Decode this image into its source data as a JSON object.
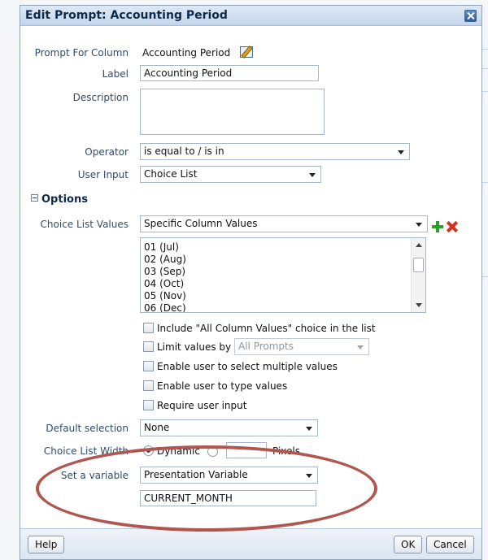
{
  "dialog": {
    "title": "Edit Prompt: Accounting Period"
  },
  "form": {
    "prompt_for_column_label": "Prompt For Column",
    "prompt_for_column_value": "Accounting Period",
    "label_label": "Label",
    "label_value": "Accounting Period",
    "description_label": "Description",
    "description_value": "",
    "operator_label": "Operator",
    "operator_value": "is equal to / is in",
    "user_input_label": "User Input",
    "user_input_value": "Choice List"
  },
  "options": {
    "section_title": "Options",
    "choice_list_values_label": "Choice List Values",
    "choice_list_values_value": "Specific Column Values",
    "list_items": [
      "01 (Jul)",
      "02 (Aug)",
      "03 (Sep)",
      "04 (Oct)",
      "05 (Nov)",
      "06 (Dec)"
    ],
    "checkboxes": {
      "include_all": "Include \"All Column Values\" choice in the list",
      "limit_values_by": "Limit values by",
      "limit_values_by_select": "All Prompts",
      "multiple_values": "Enable user to select multiple values",
      "type_values": "Enable user to type values",
      "require_input": "Require user input"
    },
    "default_selection_label": "Default selection",
    "default_selection_value": "None",
    "choice_list_width_label": "Choice List Width",
    "width_dynamic": "Dynamic",
    "width_pixels_value": "",
    "width_pixels_unit": "Pixels",
    "set_variable_label": "Set a variable",
    "set_variable_value": "Presentation Variable",
    "variable_name_value": "CURRENT_MONTH"
  },
  "footer": {
    "help": "Help",
    "ok": "OK",
    "cancel": "Cancel"
  },
  "colors": {
    "title_bar": "#c4d6ec",
    "highlight_oval": "#b0564e",
    "add_icon": "#2e9e2e",
    "remove_icon": "#d6301f"
  }
}
